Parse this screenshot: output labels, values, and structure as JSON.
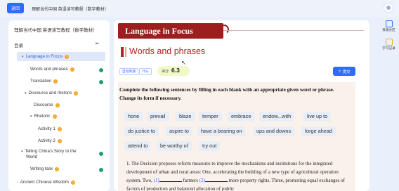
{
  "topbar": {
    "back_label": "返回",
    "app_title": "理解当代中国 英语读写教程（数字教材）"
  },
  "sidebar": {
    "book_title": "理解当代中国 英语读写教程（数字教材）",
    "toc_label": "目录",
    "items": [
      {
        "label": "Language in Focus"
      },
      {
        "label": "Words and phrases"
      },
      {
        "label": "Translation"
      },
      {
        "label": "Discourse and rhetoric"
      },
      {
        "label": "Discourse"
      },
      {
        "label": "Rhetoric"
      },
      {
        "label": "Activity 1"
      },
      {
        "label": "Activity 2"
      },
      {
        "label": "Telling China's Story to the"
      },
      {
        "label": "World"
      },
      {
        "label": "Writing task"
      },
      {
        "label": "Ancient Chinese Wisdom"
      }
    ]
  },
  "main": {
    "banner": "Language in Focus",
    "section_title": "Words and phrases",
    "tags": [
      "自动判题",
      "计分"
    ],
    "score_label": "得分:",
    "score_value": "6.3",
    "submit_label": "提交",
    "instruction": "Complete the following sentences by filling in each blank with an appropriate given word or phrase. Change its form if necessary.",
    "chips": [
      "hone",
      "prevail",
      "blaze",
      "temper",
      "embrace",
      "endow...with",
      "live up to",
      "do justice to",
      "aspire to",
      "have a bearing on",
      "ups and downs",
      "forge ahead",
      "attend to",
      "be worthy of",
      "try out"
    ],
    "para": {
      "line1": "1. The Decision proposes reform measures to improve the mechanisms and institutions for the integrated development of urban and rural areas: One, accelerating the building of a new type of agricultural operation system. Two,",
      "blank1": "(1)",
      "mid": "farmers",
      "blank2": "(2)",
      "tail": "more property rights. Three, promoting equal exchanges of factors of production and balanced allocation of public"
    }
  },
  "rail": {
    "item1": "资源分区",
    "item2": "学习记录"
  },
  "colors": {
    "accent": "#2f6bff",
    "brand_red": "#9d1e1e",
    "title_red": "#b42323",
    "check_green": "#22a06b",
    "badge_orange": "#f5a623"
  }
}
